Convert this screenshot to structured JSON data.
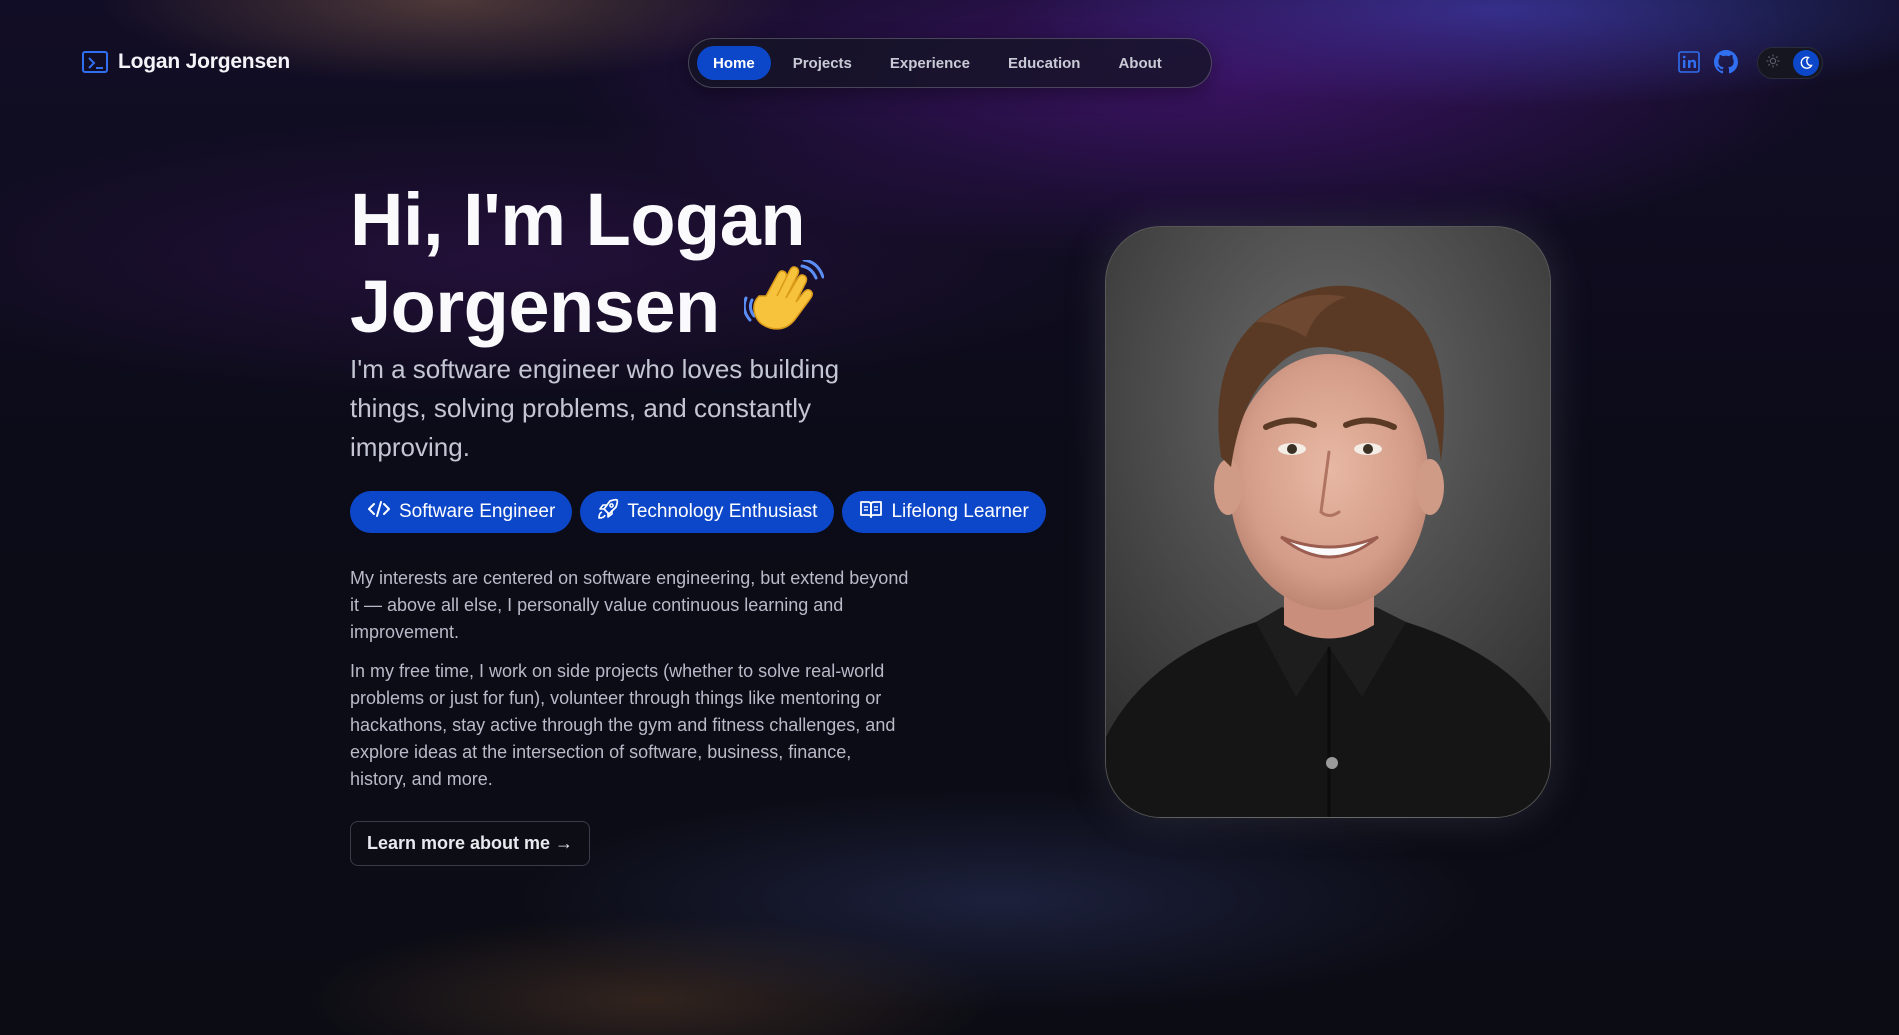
{
  "header": {
    "brand_name": "Logan Jorgensen",
    "nav": [
      "Home",
      "Projects",
      "Experience",
      "Education",
      "About"
    ],
    "active_nav": "Home"
  },
  "hero": {
    "title_line1": "Hi, I'm Logan",
    "title_line2": "Jorgensen",
    "wave_emoji": "👋",
    "subtitle": "I'm a software engineer who loves building things, solving problems, and constantly improving.",
    "tags": [
      "Software Engineer",
      "Technology Enthusiast",
      "Lifelong Learner"
    ],
    "paragraph1": "My interests are centered on software engineering, but extend beyond it — above all else, I personally value continuous learning and improvement.",
    "paragraph2": "In my free time, I work on side projects (whether to solve real-world problems or just for fun), volunteer through things like mentoring or hackathons, stay active through the gym and fitness challenges, and explore ideas at the intersection of software, business, finance, history, and more.",
    "cta_label": "Learn more about me →"
  },
  "icons": {
    "brand": "terminal-icon",
    "linkedin": "linkedin-icon",
    "github": "github-icon",
    "theme_light": "sun-icon",
    "theme_dark": "moon-icon",
    "tag_icons": [
      "code-icon",
      "rocket-icon",
      "book-icon"
    ]
  },
  "colors": {
    "accent": "#0d47c9",
    "brand_icon": "#2f6ff0",
    "background": "#0b0c14"
  }
}
